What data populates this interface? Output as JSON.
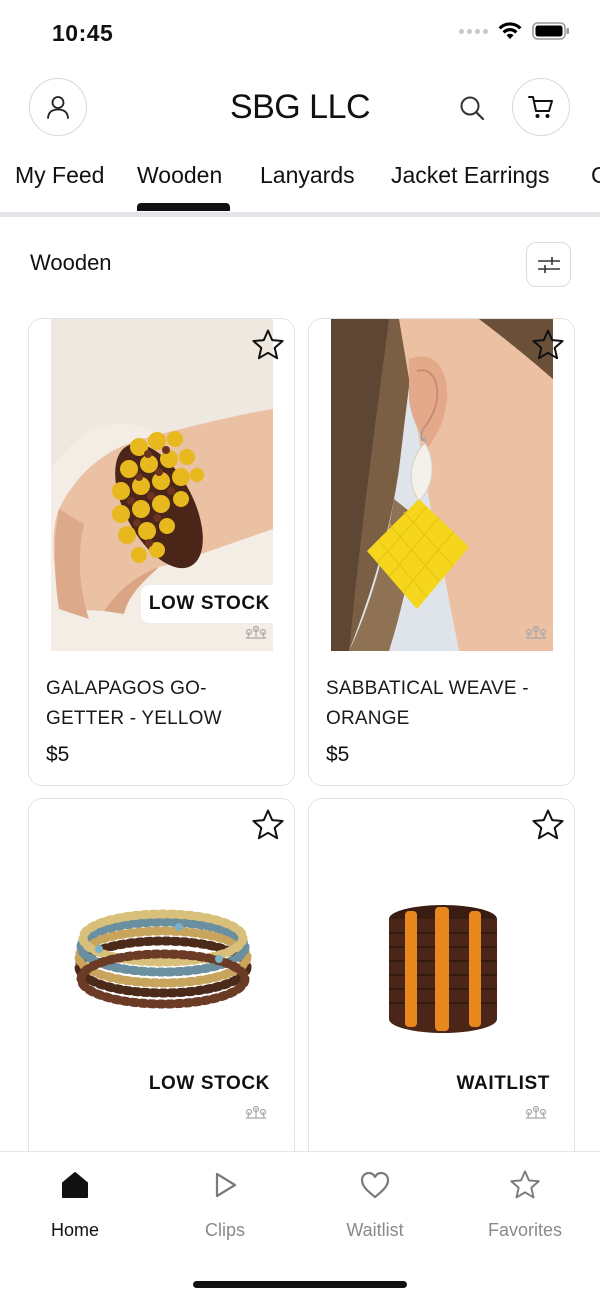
{
  "status_bar": {
    "time": "10:45"
  },
  "header": {
    "title": "SBG LLC"
  },
  "tabs": [
    {
      "label": "My Feed"
    },
    {
      "label": "Wooden"
    },
    {
      "label": "Lanyards"
    },
    {
      "label": "Jacket Earrings"
    },
    {
      "label": "C"
    }
  ],
  "section": {
    "title": "Wooden"
  },
  "products": [
    {
      "name": "GALAPAGOS GO-GETTER - YELLOW",
      "price": "$5",
      "badge": "LOW STOCK"
    },
    {
      "name": "SABBATICAL WEAVE - ORANGE",
      "price": "$5",
      "badge": ""
    },
    {
      "name": "",
      "price": "",
      "badge": "LOW STOCK"
    },
    {
      "name": "",
      "price": "",
      "badge": "WAITLIST"
    }
  ],
  "tabbar": [
    {
      "label": "Home",
      "icon": "home-icon"
    },
    {
      "label": "Clips",
      "icon": "play-icon"
    },
    {
      "label": "Waitlist",
      "icon": "heart-icon"
    },
    {
      "label": "Favorites",
      "icon": "star-icon"
    }
  ],
  "colors": {
    "accent": "#111111",
    "inactive": "#8a8a8a",
    "border": "#e3e3e3",
    "bracelet_yellow": "#e8b81f",
    "earring_yellow": "#f6d61c",
    "wood_brown": "#4a2518",
    "bead_orange": "#e8871e"
  }
}
